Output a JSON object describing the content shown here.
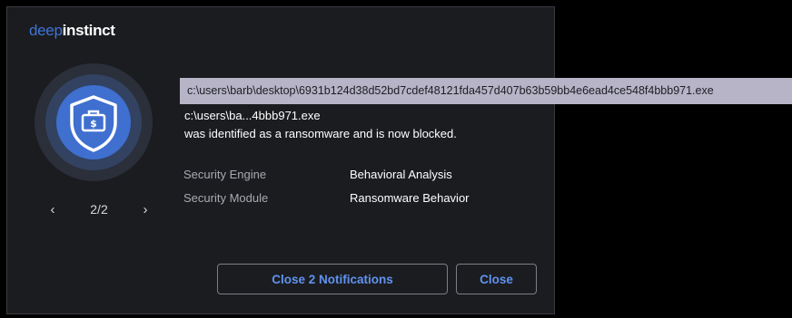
{
  "brand": {
    "deep": "deep",
    "instinct": "instinct"
  },
  "threat": {
    "full_path": "c:\\users\\barb\\desktop\\6931b124d38d52bd7cdef48121fda457d407b63b59bb4e6ead4ce548f4bbb971.exe",
    "short_path": "c:\\users\\ba...4bbb971.exe",
    "message": "was identified as a ransomware and is now blocked."
  },
  "details": [
    {
      "label": "Security Engine",
      "value": "Behavioral Analysis"
    },
    {
      "label": "Security Module",
      "value": "Ransomware Behavior"
    }
  ],
  "pager": {
    "prev_icon": "‹",
    "next_icon": "›",
    "label": "2/2"
  },
  "buttons": {
    "close_all": "Close 2 Notifications",
    "close": "Close"
  },
  "colors": {
    "accent": "#3f6fcf",
    "button_text": "#5f93ee",
    "panel_bg": "#1b1c20"
  },
  "icons": {
    "shield": "shield-dollar-icon"
  }
}
